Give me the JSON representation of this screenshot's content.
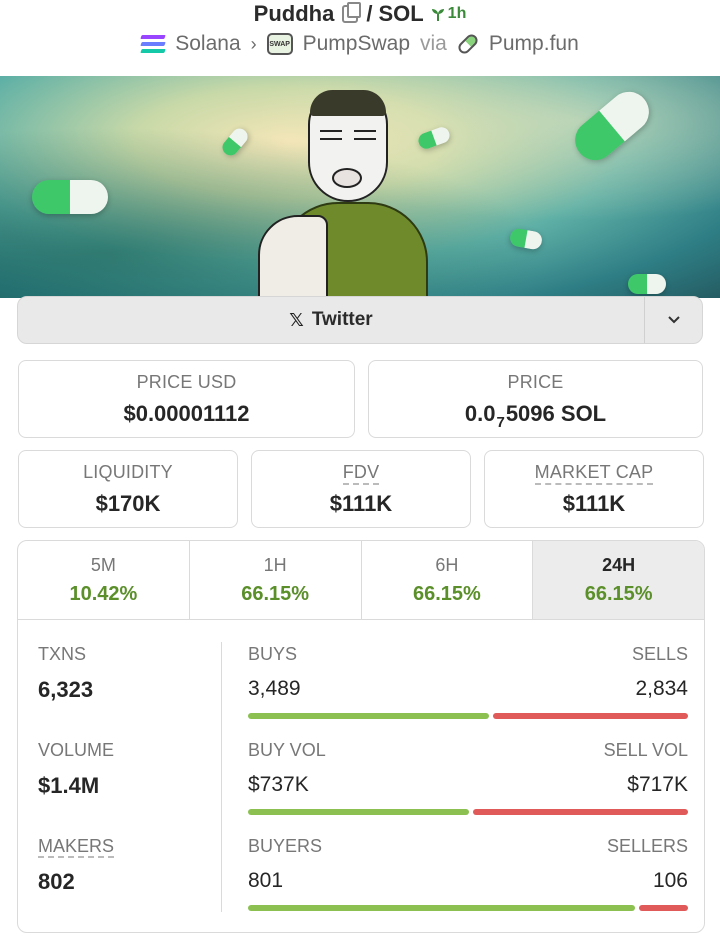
{
  "header": {
    "token": "Puddha",
    "separator": "/",
    "quote": "SOL",
    "age": "1h",
    "chain": "Solana",
    "dex": "PumpSwap",
    "via": "via",
    "launchpad": "Pump.fun",
    "swap_badge": "SWAP"
  },
  "social": {
    "twitter_label": "Twitter",
    "x_glyph": "𝕏"
  },
  "price_usd": {
    "label": "PRICE USD",
    "value": "$0.00001112"
  },
  "price_native": {
    "label": "PRICE",
    "prefix": "0.0",
    "zeros": "7",
    "digits": "5096",
    "unit": "SOL"
  },
  "liquidity": {
    "label": "LIQUIDITY",
    "value": "$170K"
  },
  "fdv": {
    "label": "FDV",
    "value": "$111K"
  },
  "market_cap": {
    "label": "MARKET CAP",
    "value": "$111K"
  },
  "timeframes": [
    {
      "label": "5M",
      "change": "10.42%"
    },
    {
      "label": "1H",
      "change": "66.15%"
    },
    {
      "label": "6H",
      "change": "66.15%"
    },
    {
      "label": "24H",
      "change": "66.15%",
      "active": true
    }
  ],
  "txns": {
    "label": "TXNS",
    "value": "6,323",
    "buys_label": "BUYS",
    "buys": "3,489",
    "sells_label": "SELLS",
    "sells": "2,834",
    "buy_share": 0.552
  },
  "volume": {
    "label": "VOLUME",
    "value": "$1.4M",
    "buy_label": "BUY VOL",
    "buy": "$737K",
    "sell_label": "SELL VOL",
    "sell": "$717K",
    "buy_share": 0.507
  },
  "makers": {
    "label": "MAKERS",
    "value": "802",
    "buyers_label": "BUYERS",
    "buyers": "801",
    "sellers_label": "SELLERS",
    "sellers": "106",
    "buy_share": 0.883
  },
  "colors": {
    "positive": "#5a8f2a",
    "buy_bar": "#8cc152",
    "sell_bar": "#e05a5a",
    "age": "#3a8a3a"
  },
  "icons": [
    "copy-icon",
    "sprout-icon",
    "solana-icon",
    "chevron-right-icon",
    "pumpswap-icon",
    "pill-icon",
    "x-icon",
    "chevron-down-icon"
  ]
}
